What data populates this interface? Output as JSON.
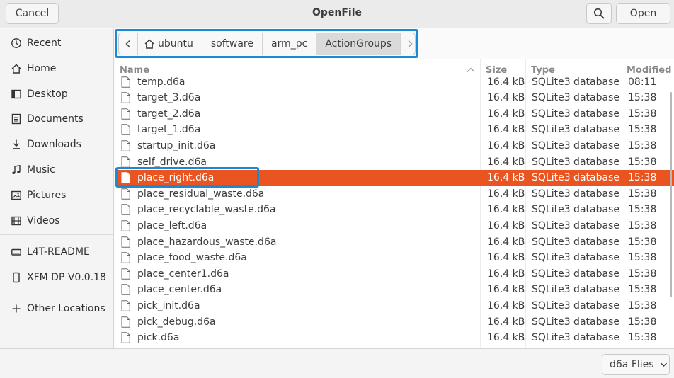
{
  "header": {
    "title": "OpenFile",
    "cancel_label": "Cancel",
    "open_label": "Open"
  },
  "sidebar": {
    "items": [
      {
        "label": "Recent",
        "icon": "clock-icon"
      },
      {
        "label": "Home",
        "icon": "home-icon"
      },
      {
        "label": "Desktop",
        "icon": "desktop-icon"
      },
      {
        "label": "Documents",
        "icon": "document-icon"
      },
      {
        "label": "Downloads",
        "icon": "download-icon"
      },
      {
        "label": "Music",
        "icon": "music-icon"
      },
      {
        "label": "Pictures",
        "icon": "picture-icon"
      },
      {
        "label": "Videos",
        "icon": "video-icon"
      },
      {
        "label": "L4T-README",
        "icon": "drive-icon"
      },
      {
        "label": "XFM DP V0.0.18",
        "icon": "phone-icon"
      },
      {
        "label": "Other Locations",
        "icon": "plus-icon"
      }
    ]
  },
  "pathbar": {
    "crumbs": [
      "ubuntu",
      "software",
      "arm_pc",
      "ActionGroups"
    ],
    "active": "ActionGroups"
  },
  "columns": {
    "name": "Name",
    "size": "Size",
    "type": "Type",
    "modified": "Modified"
  },
  "files": [
    {
      "name": "temp.d6a",
      "size": "16.4 kB",
      "type": "SQLite3 database",
      "modified": "08:11"
    },
    {
      "name": "target_3.d6a",
      "size": "16.4 kB",
      "type": "SQLite3 database",
      "modified": "15:38"
    },
    {
      "name": "target_2.d6a",
      "size": "16.4 kB",
      "type": "SQLite3 database",
      "modified": "15:38"
    },
    {
      "name": "target_1.d6a",
      "size": "16.4 kB",
      "type": "SQLite3 database",
      "modified": "15:38"
    },
    {
      "name": "startup_init.d6a",
      "size": "16.4 kB",
      "type": "SQLite3 database",
      "modified": "15:38"
    },
    {
      "name": "self_drive.d6a",
      "size": "16.4 kB",
      "type": "SQLite3 database",
      "modified": "15:38"
    },
    {
      "name": "place_right.d6a",
      "size": "16.4 kB",
      "type": "SQLite3 database",
      "modified": "15:38",
      "selected": true
    },
    {
      "name": "place_residual_waste.d6a",
      "size": "16.4 kB",
      "type": "SQLite3 database",
      "modified": "15:38"
    },
    {
      "name": "place_recyclable_waste.d6a",
      "size": "16.4 kB",
      "type": "SQLite3 database",
      "modified": "15:38"
    },
    {
      "name": "place_left.d6a",
      "size": "16.4 kB",
      "type": "SQLite3 database",
      "modified": "15:38"
    },
    {
      "name": "place_hazardous_waste.d6a",
      "size": "16.4 kB",
      "type": "SQLite3 database",
      "modified": "15:38"
    },
    {
      "name": "place_food_waste.d6a",
      "size": "16.4 kB",
      "type": "SQLite3 database",
      "modified": "15:38"
    },
    {
      "name": "place_center1.d6a",
      "size": "16.4 kB",
      "type": "SQLite3 database",
      "modified": "15:38"
    },
    {
      "name": "place_center.d6a",
      "size": "16.4 kB",
      "type": "SQLite3 database",
      "modified": "15:38"
    },
    {
      "name": "pick_init.d6a",
      "size": "16.4 kB",
      "type": "SQLite3 database",
      "modified": "15:38"
    },
    {
      "name": "pick_debug.d6a",
      "size": "16.4 kB",
      "type": "SQLite3 database",
      "modified": "15:38"
    },
    {
      "name": "pick.d6a",
      "size": "16.4 kB",
      "type": "SQLite3 database",
      "modified": "15:38"
    }
  ],
  "footer": {
    "filter_label": "d6a Flies"
  },
  "colors": {
    "selection": "#e95420",
    "highlight_outline": "#1a8ad6"
  }
}
